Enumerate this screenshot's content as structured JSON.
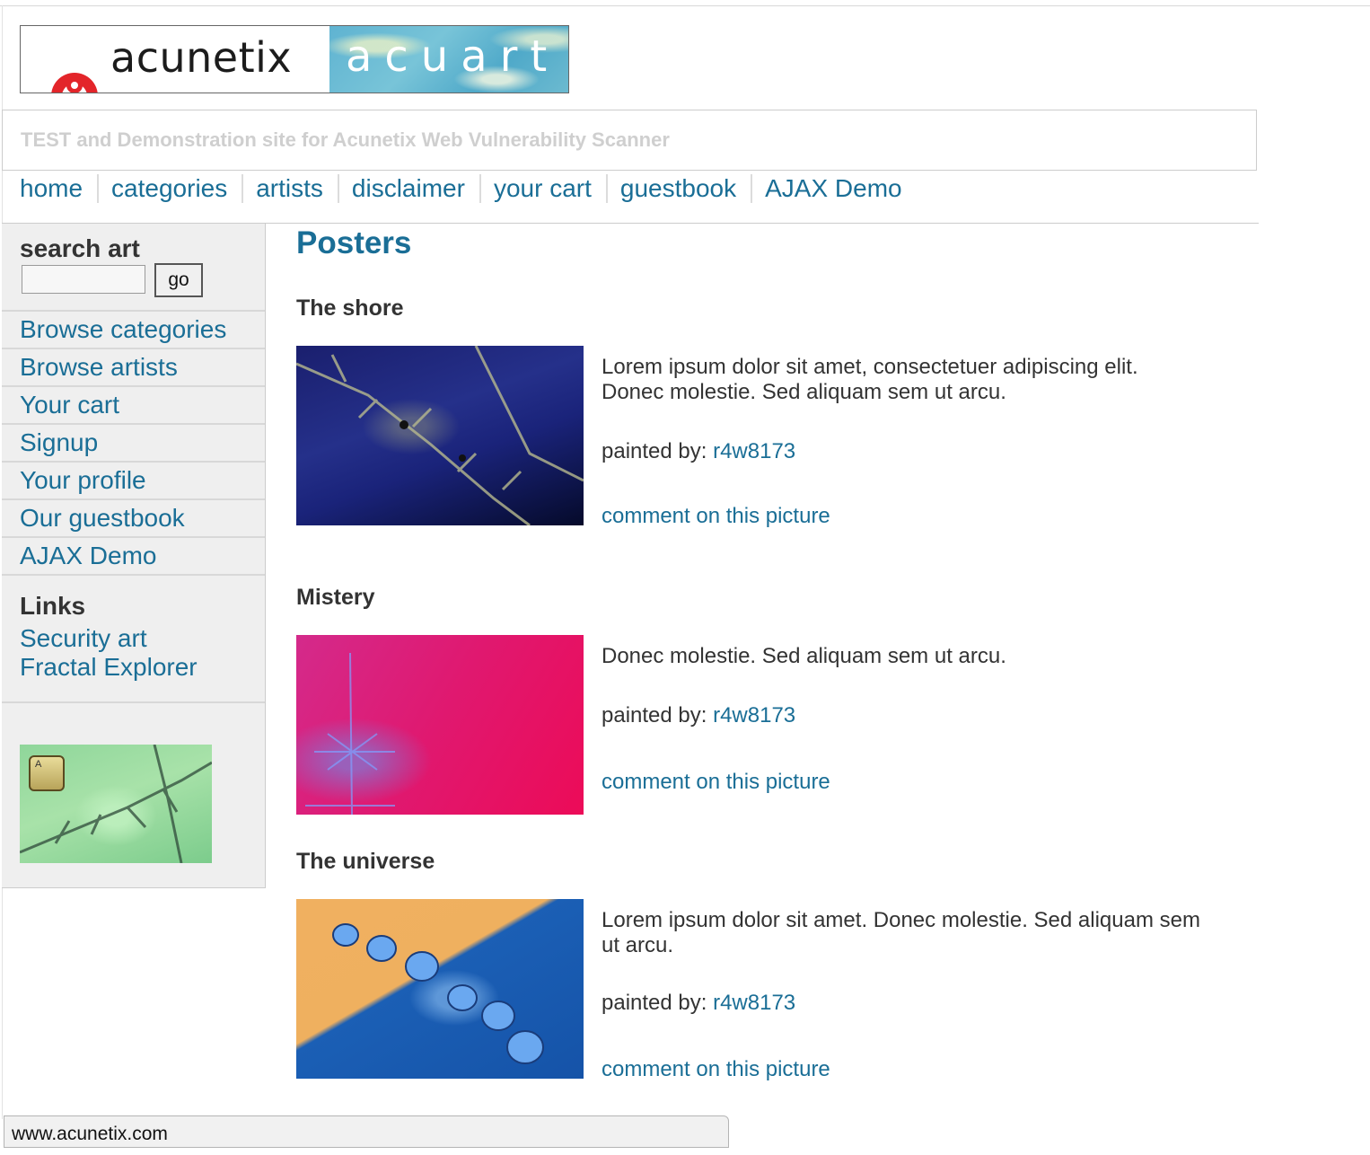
{
  "header": {
    "logo_brand": "acunetix",
    "logo_product": "acuart",
    "tagline": "TEST and Demonstration site for Acunetix Web Vulnerability Scanner"
  },
  "nav": [
    "home",
    "categories",
    "artists",
    "disclaimer",
    "your cart",
    "guestbook",
    "AJAX Demo"
  ],
  "sidebar": {
    "search_title": "search art",
    "search_value": "",
    "go_label": "go",
    "menu": [
      "Browse categories",
      "Browse artists",
      "Your cart",
      "Signup",
      "Your profile",
      "Our guestbook",
      "AJAX Demo"
    ],
    "links_title": "Links",
    "links": [
      "Security art",
      "Fractal Explorer"
    ],
    "ad_key_label": "A"
  },
  "main": {
    "title": "Posters",
    "painted_by_label": "painted by: ",
    "comment_label": "comment on this picture",
    "posters": [
      {
        "title": "The shore",
        "desc": "Lorem ipsum dolor sit amet, consectetuer adipiscing elit. Donec molestie. Sed aliquam sem ut arcu.",
        "artist": "r4w8173"
      },
      {
        "title": "Mistery",
        "desc": "Donec molestie. Sed aliquam sem ut arcu.",
        "artist": "r4w8173"
      },
      {
        "title": "The universe",
        "desc": "Lorem ipsum dolor sit amet. Donec molestie. Sed aliquam sem ut arcu.",
        "artist": "r4w8173"
      }
    ]
  },
  "statusbar": {
    "url": "www.acunetix.com"
  },
  "colors": {
    "link": "#1a6e96",
    "text": "#333333",
    "logo_red": "#e3252a"
  }
}
